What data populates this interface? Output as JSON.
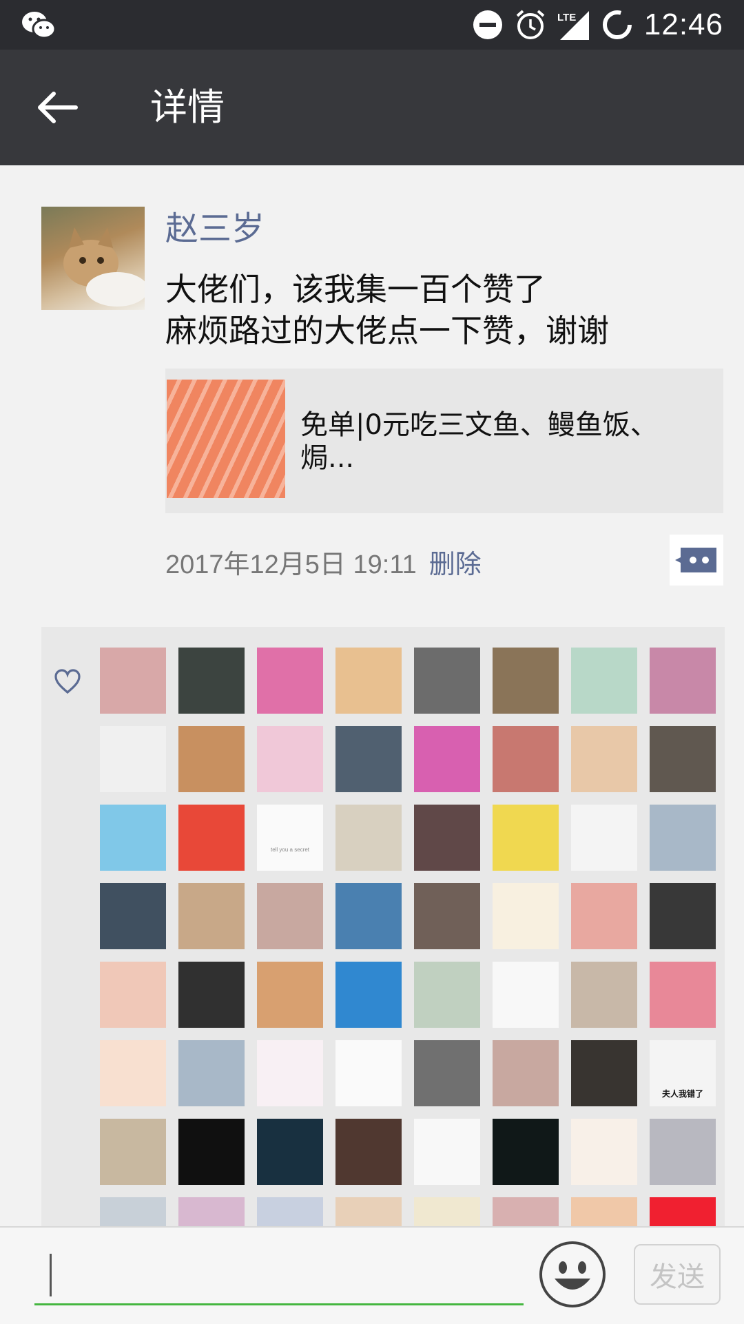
{
  "status_bar": {
    "time": "12:46",
    "network": "LTE",
    "icons": [
      "wechat-icon",
      "do-not-disturb-icon",
      "alarm-icon",
      "signal-lte-icon",
      "battery-charging-icon"
    ]
  },
  "header": {
    "title": "详情",
    "back_icon": "arrow-left-icon"
  },
  "post": {
    "author": "赵三岁",
    "text": "大佬们，该我集一百个赞了\n麻烦路过的大佬点一下赞，谢谢",
    "link_card": {
      "title": "免单|0元吃三文鱼、鳗鱼饭、焗..."
    },
    "timestamp": "2017年12月5日 19:11",
    "delete_label": "删除",
    "comment_icon": "comment-bubble-icon"
  },
  "likes": {
    "icon": "heart-icon",
    "avatar_colors": [
      "#d8a8a8",
      "#3c4440",
      "#e070a8",
      "#e8c090",
      "#6c6c6c",
      "#8a7458",
      "#b8d8c8",
      "#c888a8",
      "#f0f0f0",
      "#c89060",
      "#f0c8d8",
      "#506070",
      "#d860b0",
      "#c87870",
      "#e8c8a8",
      "#605850",
      "#80c8e8",
      "#e84838",
      "#fafafa",
      "#d8d0c0",
      "#604848",
      "#f0d850",
      "#f4f4f4",
      "#a8b8c8",
      "#405060",
      "#c8a888",
      "#c8a8a0",
      "#4a80b0",
      "#706058",
      "#f8f0e0",
      "#e8a8a0",
      "#383838",
      "#f0c8b8",
      "#303030",
      "#d8a070",
      "#3088d0",
      "#c0d0c0",
      "#f8f8f8",
      "#c8b8a8",
      "#e88898",
      "#f8e0d0",
      "#a8b8c8",
      "#f8f0f4",
      "#fafafa",
      "#707070",
      "#c8a8a0",
      "#383430",
      "#f4f4f4",
      "#c8b8a0",
      "#101010",
      "#183040",
      "#503830",
      "#f8f8f8",
      "#101818",
      "#f8f0e8",
      "#b8b8c0",
      "#c8d0d8",
      "#d8b8d0",
      "#c8d0e0",
      "#e8d0b8",
      "#f0e8d0",
      "#d8b0b0",
      "#f0c8a8",
      "#f02030"
    ],
    "special_labels": {
      "tell_secret": "tell you a secret",
      "wife_sorry": "夫人我错了"
    }
  },
  "input_bar": {
    "value": "",
    "emoji_icon": "smiley-icon",
    "send_label": "发送"
  }
}
